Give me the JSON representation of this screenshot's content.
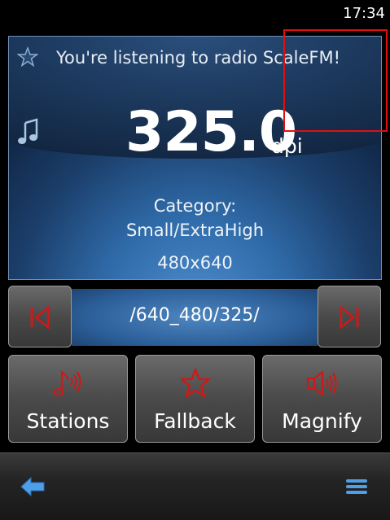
{
  "status_bar": {
    "time": "17:34"
  },
  "display": {
    "listening_text": "You're listening to radio ScaleFM!",
    "frequency": "325.0",
    "unit": "dpi",
    "category_label": "Category:",
    "category_value": "Small/ExtraHigh",
    "resolution": "480x640",
    "icons": {
      "favorite": "star-icon",
      "music": "music-note-icon"
    }
  },
  "navigation": {
    "path": "/640_480/325/",
    "prev_icon": "skip-previous-icon",
    "next_icon": "skip-next-icon"
  },
  "actions": [
    {
      "label": "Stations",
      "icon": "radio-waves-icon"
    },
    {
      "label": "Fallback",
      "icon": "star-icon"
    },
    {
      "label": "Magnify",
      "icon": "speaker-icon"
    }
  ],
  "toolbar": {
    "back_icon": "back-arrow-icon",
    "menu_icon": "menu-icon"
  },
  "colors": {
    "accent_red": "#d01818",
    "display_blue": "#2f6aa8",
    "annotation_red": "#e01010"
  }
}
